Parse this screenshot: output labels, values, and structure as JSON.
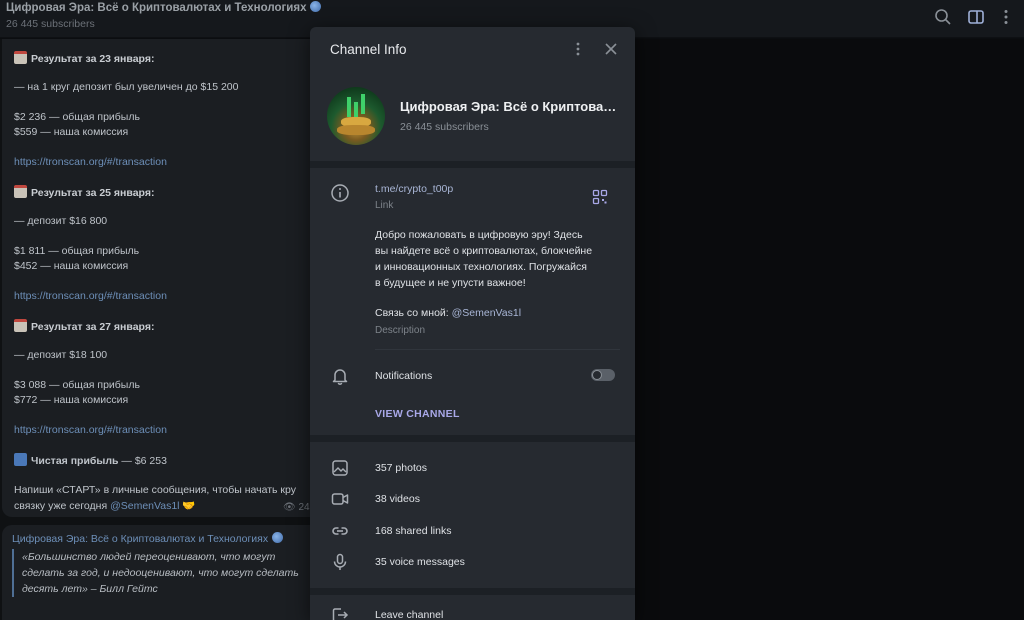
{
  "header": {
    "title": "Цифровая Эра: Всё о Криптовалютах и Технологиях",
    "subscribers": "26 445 subscribers",
    "icons": [
      "search-icon",
      "sidebar-toggle-icon",
      "more-icon"
    ]
  },
  "chat": {
    "message1": {
      "lines": [
        {
          "text": "Результат за 23 января:",
          "kind": "heading",
          "icon": "calendar-icon"
        },
        {
          "text": "— на 1 круг депозит был увеличен до $15 200"
        },
        {
          "text": "$2 236 — общая прибыль"
        },
        {
          "text": "$559 — наша комиссия"
        },
        {
          "text": "https://tronscan.org/#/transaction",
          "kind": "link"
        },
        {
          "text": "Результат за 25 января:",
          "kind": "heading",
          "icon": "calendar-icon"
        },
        {
          "text": "— депозит $16 800"
        },
        {
          "text": "$1 811 — общая прибыль"
        },
        {
          "text": "$452 — наша комиссия"
        },
        {
          "text": "https://tronscan.org/#/transaction",
          "kind": "link"
        },
        {
          "text": "Результат за 27 января:",
          "kind": "heading",
          "icon": "calendar-icon"
        },
        {
          "text": "— депозит $18 100"
        },
        {
          "text": "$3 088 — общая прибыль"
        },
        {
          "text": "$772 — наша комиссия"
        },
        {
          "text": "https://tronscan.org/#/transaction",
          "kind": "link"
        }
      ],
      "net_profit_label": "Чистая прибыль",
      "net_profit_value": "— $6 253",
      "cta_line1": "Напиши «СТАРТ» в личные сообщения, чтобы начать кру",
      "cta_line2": "связку уже сегодня",
      "cta_mention": "@SemenVas1l",
      "views": "24"
    },
    "message2": {
      "channel_title": "Цифровая Эра: Всё о Криптовалютах и Технологиях",
      "quote_line1": "«Большинство людей переоценивают, что могут",
      "quote_line2": "сделать за год, и недооценивают, что могут сделать",
      "quote_line3": "десять лет» – Билл Гейтс"
    }
  },
  "modal": {
    "title": "Channel Info",
    "channel_name": "Цифровая Эра: Всё о Криптовалютах и Технологиях",
    "subscribers": "26 445 subscribers",
    "link": "t.me/crypto_t00p",
    "link_label": "Link",
    "description_line1": "Добро пожаловать в цифровую эру! Здесь",
    "description_line2": "вы найдете всё о криптовалютах, блокчейне",
    "description_line3": "и инновационных технологиях. Погружайся",
    "description_line4": "в будущее и не упусти важное!",
    "contact_prefix": "Связь со мной:",
    "contact_mention": "@SemenVas1l",
    "description_label": "Description",
    "notifications_label": "Notifications",
    "notifications_on": false,
    "view_channel": "VIEW CHANNEL",
    "media": {
      "photos": "357 photos",
      "videos": "38 videos",
      "links": "168 shared links",
      "voice": "35 voice messages"
    },
    "leave": "Leave channel"
  },
  "colors": {
    "accent_link": "#a9b6d6",
    "view_channel": "#a9a8e8",
    "modal_bg": "#262a30"
  }
}
